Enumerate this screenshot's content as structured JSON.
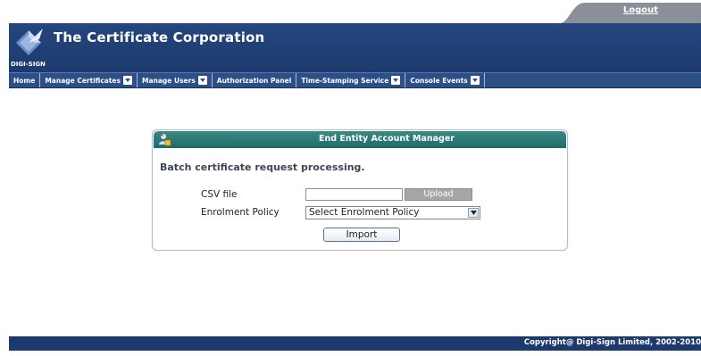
{
  "header": {
    "brand_name": "The Certificate Corporation",
    "brand_sub": "DIGI-SIGN",
    "logout_label": "Logout"
  },
  "nav": {
    "items": [
      {
        "label": "Home",
        "has_dropdown": false
      },
      {
        "label": "Manage Certificates",
        "has_dropdown": true
      },
      {
        "label": "Manage Users",
        "has_dropdown": true
      },
      {
        "label": "Authorization Panel",
        "has_dropdown": false
      },
      {
        "label": "Time-Stamping Service",
        "has_dropdown": true
      },
      {
        "label": "Console Events",
        "has_dropdown": true
      }
    ]
  },
  "dialog": {
    "title": "End Entity Account Manager",
    "heading": "Batch certificate request processing.",
    "csv_label": "CSV file",
    "csv_value": "",
    "upload_label": "Upload",
    "policy_label": "Enrolment Policy",
    "policy_selected": "Select Enrolment Policy",
    "import_label": "Import"
  },
  "footer": {
    "copyright": "Copyright@ Digi-Sign Limited, 2002-2010"
  },
  "colors": {
    "banner": "#1c3a6e",
    "navbar": "#2d4f87",
    "dialog_header": "#1f6a67",
    "footer": "#1c3a6e",
    "upload_button": "#a6a6a6"
  },
  "icons": {
    "logo": "diamond-logo-icon",
    "dialog": "user-lock-icon",
    "dropdown": "chevron-down-icon"
  }
}
